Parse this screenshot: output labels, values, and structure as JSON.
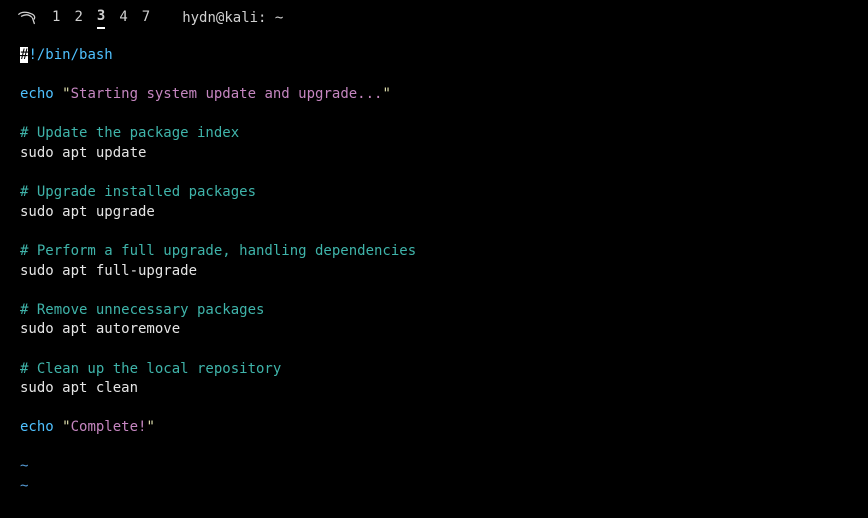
{
  "titlebar": {
    "tabs": [
      "1",
      "2",
      "3",
      "4",
      "7"
    ],
    "active_tab_index": 2,
    "title": "hydn@kali: ~"
  },
  "script": {
    "shebang_first": "#",
    "shebang_rest": "!/bin/bash",
    "echo1_kw": "echo ",
    "echo1_q1": "\"",
    "echo1_str": "Starting system update and upgrade...",
    "echo1_q2": "\"",
    "c1": "# Update the package index",
    "l1": "sudo apt update",
    "c2": "# Upgrade installed packages",
    "l2": "sudo apt upgrade",
    "c3": "# Perform a full upgrade, handling dependencies",
    "l3": "sudo apt full-upgrade",
    "c4": "# Remove unnecessary packages",
    "l4": "sudo apt autoremove",
    "c5": "# Clean up the local repository",
    "l5": "sudo apt clean",
    "echo2_kw": "echo ",
    "echo2_q1": "\"",
    "echo2_str": "Complete!",
    "echo2_q2": "\"",
    "tilde": "~"
  }
}
